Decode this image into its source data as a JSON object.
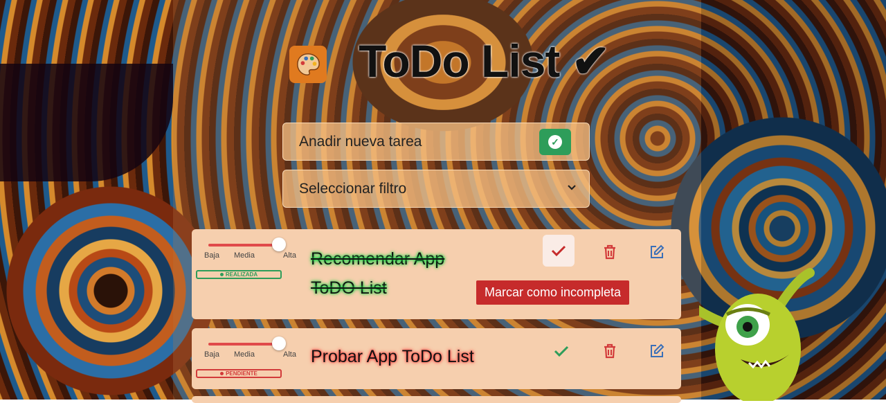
{
  "app": {
    "title": "ToDo List ✔",
    "logo_icon": "palette-icon"
  },
  "new_task": {
    "placeholder": "Anadir nueva tarea",
    "submit_icon": "check-circle-icon",
    "accent": "#2e9d5a"
  },
  "filter": {
    "placeholder": "Seleccionar filtro",
    "icon": "chevron-down-icon"
  },
  "priority_labels": {
    "low": "Baja",
    "medium": "Media",
    "high": "Alta"
  },
  "tasks": [
    {
      "title": "Recomendar App ToDO List",
      "status": "REALIZADA",
      "priority_level": 1.0,
      "tooltip": "Marcar como incompleta",
      "status_color": "#2e9d5a"
    },
    {
      "title": "Probar App ToDo List",
      "status": "PENDIENTE",
      "priority_level": 1.0,
      "status_color": "#d23a3a"
    }
  ],
  "colors": {
    "delete": "#d23a3a",
    "edit": "#3a6fb8",
    "done_check": "#c62b2b",
    "pending_check": "#2e9d5a"
  }
}
